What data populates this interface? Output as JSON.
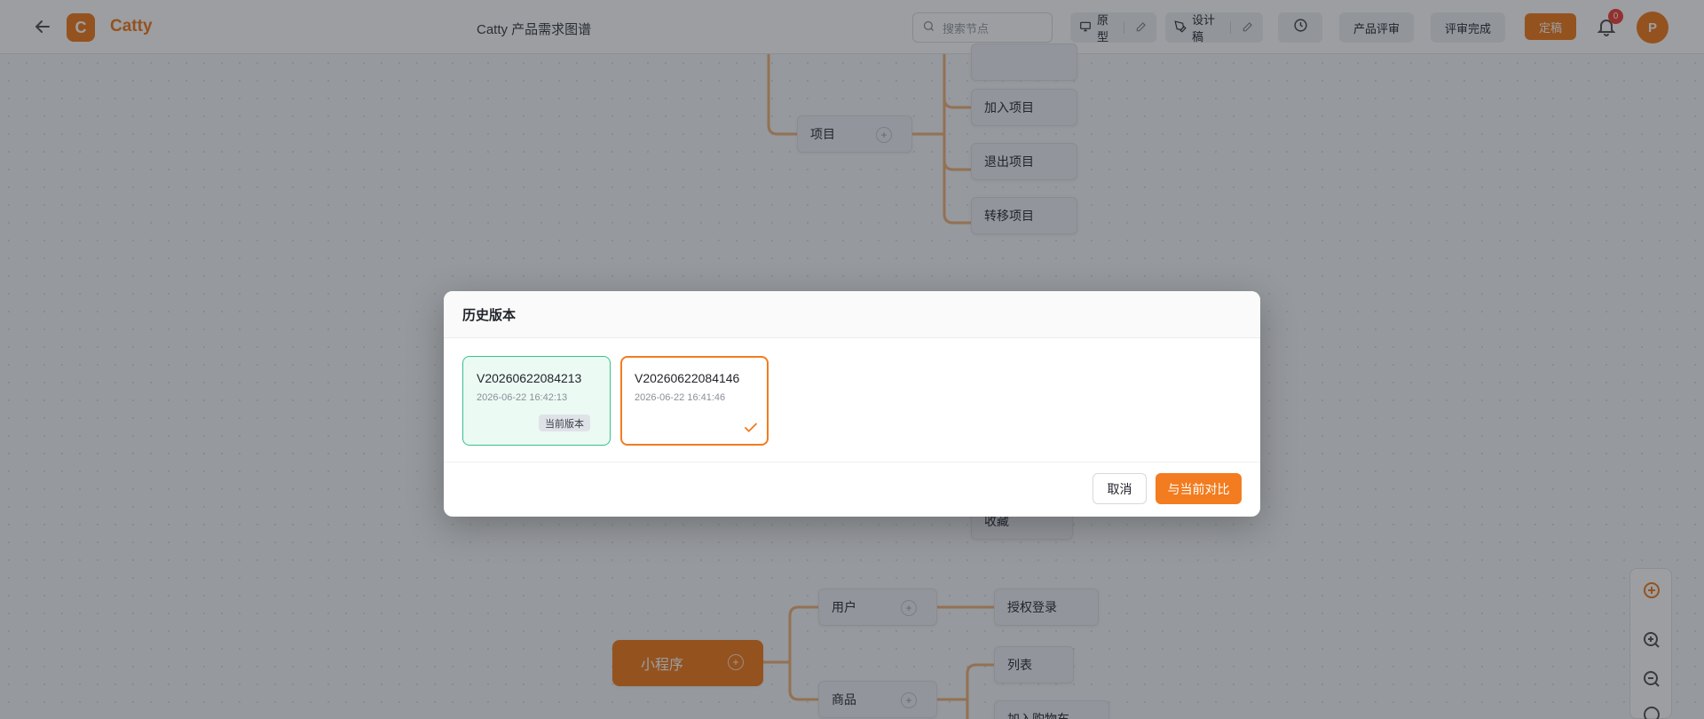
{
  "header": {
    "logo_letter": "C",
    "brand": "Catty",
    "doc_title": "Catty 产品需求图谱",
    "search_placeholder": "搜索节点",
    "prototype_label": "原型",
    "design_label": "设计稿",
    "review_label": "产品评审",
    "review_done_label": "评审完成",
    "publish_label": "定稿",
    "notification_count": "0",
    "avatar_initial": "P"
  },
  "mindmap": {
    "nodes": {
      "project": "项目",
      "join_project": "加入项目",
      "quit_project": "退出项目",
      "transfer_project": "转移项目",
      "favorite": "收藏",
      "miniapp": "小程序",
      "user": "用户",
      "auth_login": "授权登录",
      "product": "商品",
      "list": "列表",
      "add_cart": "加入购物车"
    }
  },
  "modal": {
    "title": "历史版本",
    "versions": [
      {
        "name": "V20260622084213",
        "time": "2026-06-22 16:42:13",
        "tag": "当前版本"
      },
      {
        "name": "V20260622084146",
        "time": "2026-06-22 16:41:46"
      }
    ],
    "cancel_label": "取消",
    "compare_label": "与当前对比"
  },
  "colors": {
    "accent": "#f27c1f",
    "current_border": "#35c28d",
    "current_bg": "#ebfaf3",
    "badge": "#f0443c"
  }
}
